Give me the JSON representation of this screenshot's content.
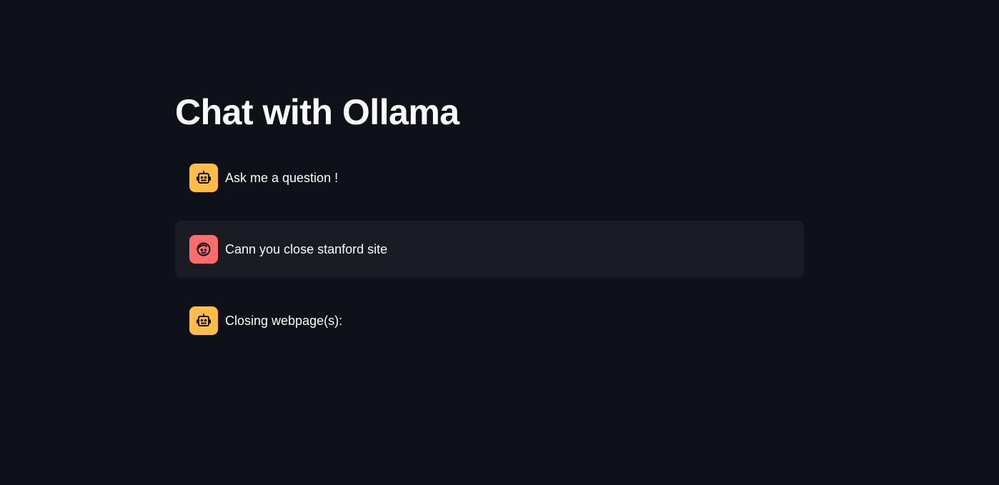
{
  "page": {
    "title": "Chat with Ollama"
  },
  "messages": [
    {
      "role": "assistant",
      "avatar_icon": "robot-icon",
      "avatar_color": "#ffbd45",
      "text": "Ask me a question !"
    },
    {
      "role": "user",
      "avatar_icon": "user-face-icon",
      "avatar_color": "#ff6c6c",
      "text": "Cann you close stanford site"
    },
    {
      "role": "assistant",
      "avatar_icon": "robot-icon",
      "avatar_color": "#ffbd45",
      "text": "Closing webpage(s):"
    }
  ],
  "colors": {
    "background": "#0e1117",
    "user_message_bg": "#1a1c24",
    "text": "#fafafa"
  }
}
